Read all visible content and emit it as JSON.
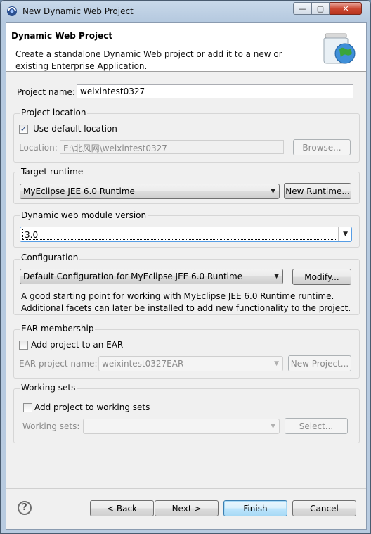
{
  "window": {
    "title": "New Dynamic Web Project"
  },
  "header": {
    "title": "Dynamic Web Project",
    "description": "Create a standalone Dynamic Web project or add it to a new or existing Enterprise Application."
  },
  "project_name": {
    "label": "Project name:",
    "value": "weixintest0327"
  },
  "project_location": {
    "group_title": "Project location",
    "use_default_label": "Use default location",
    "use_default_checked": true,
    "location_label": "Location:",
    "location_value": "E:\\北风网\\weixintest0327",
    "browse_label": "Browse..."
  },
  "target_runtime": {
    "group_title": "Target runtime",
    "selected": "MyEclipse JEE 6.0 Runtime",
    "new_runtime_label": "New Runtime..."
  },
  "module_version": {
    "group_title": "Dynamic web module version",
    "selected": "3.0"
  },
  "configuration": {
    "group_title": "Configuration",
    "selected": "Default Configuration for MyEclipse JEE 6.0 Runtime",
    "modify_label": "Modify...",
    "description": "A good starting point for working with MyEclipse JEE 6.0 Runtime runtime. Additional facets can later be installed to add new functionality to the project."
  },
  "ear": {
    "group_title": "EAR membership",
    "add_label": "Add project to an EAR",
    "add_checked": false,
    "project_name_label": "EAR project name:",
    "project_name_value": "weixintest0327EAR",
    "new_project_label": "New Project..."
  },
  "working_sets": {
    "group_title": "Working sets",
    "add_label": "Add project to working sets",
    "add_checked": false,
    "label": "Working sets:",
    "value": "",
    "select_label": "Select..."
  },
  "footer": {
    "back_label": "< Back",
    "next_label": "Next >",
    "finish_label": "Finish",
    "cancel_label": "Cancel"
  },
  "colors": {
    "accent": "#3c7fb1",
    "close_button": "#c9452f"
  }
}
